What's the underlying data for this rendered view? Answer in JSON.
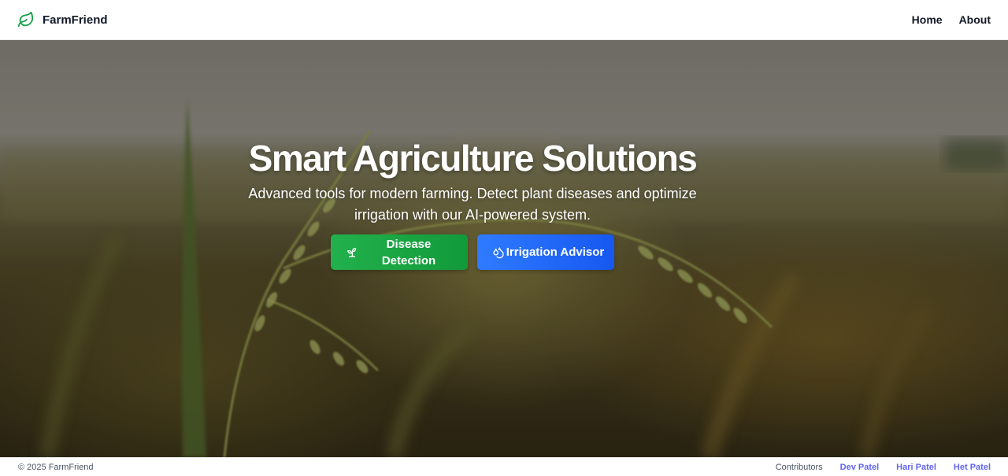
{
  "navbar": {
    "brand": "FarmFriend",
    "brand_icon": "leaf-icon",
    "links": [
      "Home",
      "About"
    ]
  },
  "hero": {
    "title": "Smart Agriculture Solutions",
    "subtitle": "Advanced tools for modern farming. Detect plant diseases and optimize irrigation with our AI-powered system.",
    "buttons": [
      {
        "label": "Disease Detection",
        "icon": "sprout-icon",
        "color": "#16a34a"
      },
      {
        "label": "Irrigation Advisor",
        "icon": "droplets-icon",
        "color": "#2563eb"
      }
    ]
  },
  "footer": {
    "copyright": "© 2025 FarmFriend",
    "contributors_label": "Contributors",
    "contributors": [
      "Dev Patel",
      "Hari Patel",
      "Het Patel"
    ]
  },
  "colors": {
    "brand_green": "#16a34a",
    "link_purple": "#6366f1"
  }
}
